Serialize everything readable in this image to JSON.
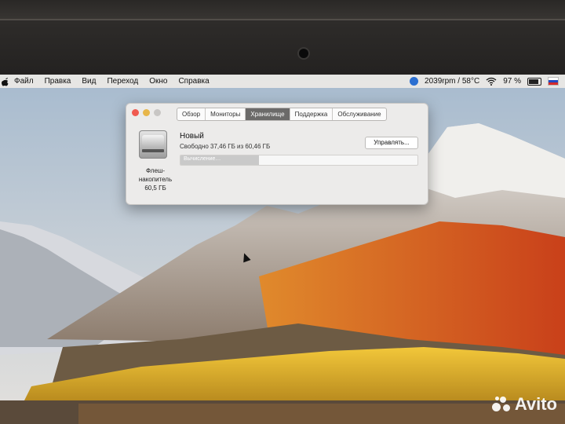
{
  "menubar": {
    "items": [
      "Файл",
      "Правка",
      "Вид",
      "Переход",
      "Окно",
      "Справка"
    ],
    "status": {
      "fan": "2039rpm / 58°C",
      "battery": "97 %"
    }
  },
  "window": {
    "tabs": [
      "Обзор",
      "Мониторы",
      "Хранилище",
      "Поддержка",
      "Обслуживание"
    ],
    "active_tab": "Хранилище",
    "volume": {
      "name": "Новый",
      "free": "Свободно 37,46 ГБ из 60,46 ГБ",
      "progress_text": "Вычисление…",
      "used_fraction": 0.33
    },
    "disk_label": "Флеш-накопитель 60,5 ГБ",
    "manage_label": "Управлять..."
  },
  "watermark": "Avito",
  "colors": {
    "accent": "#6b6a69",
    "close": "#f05a50",
    "minimize": "#e7b64a"
  }
}
